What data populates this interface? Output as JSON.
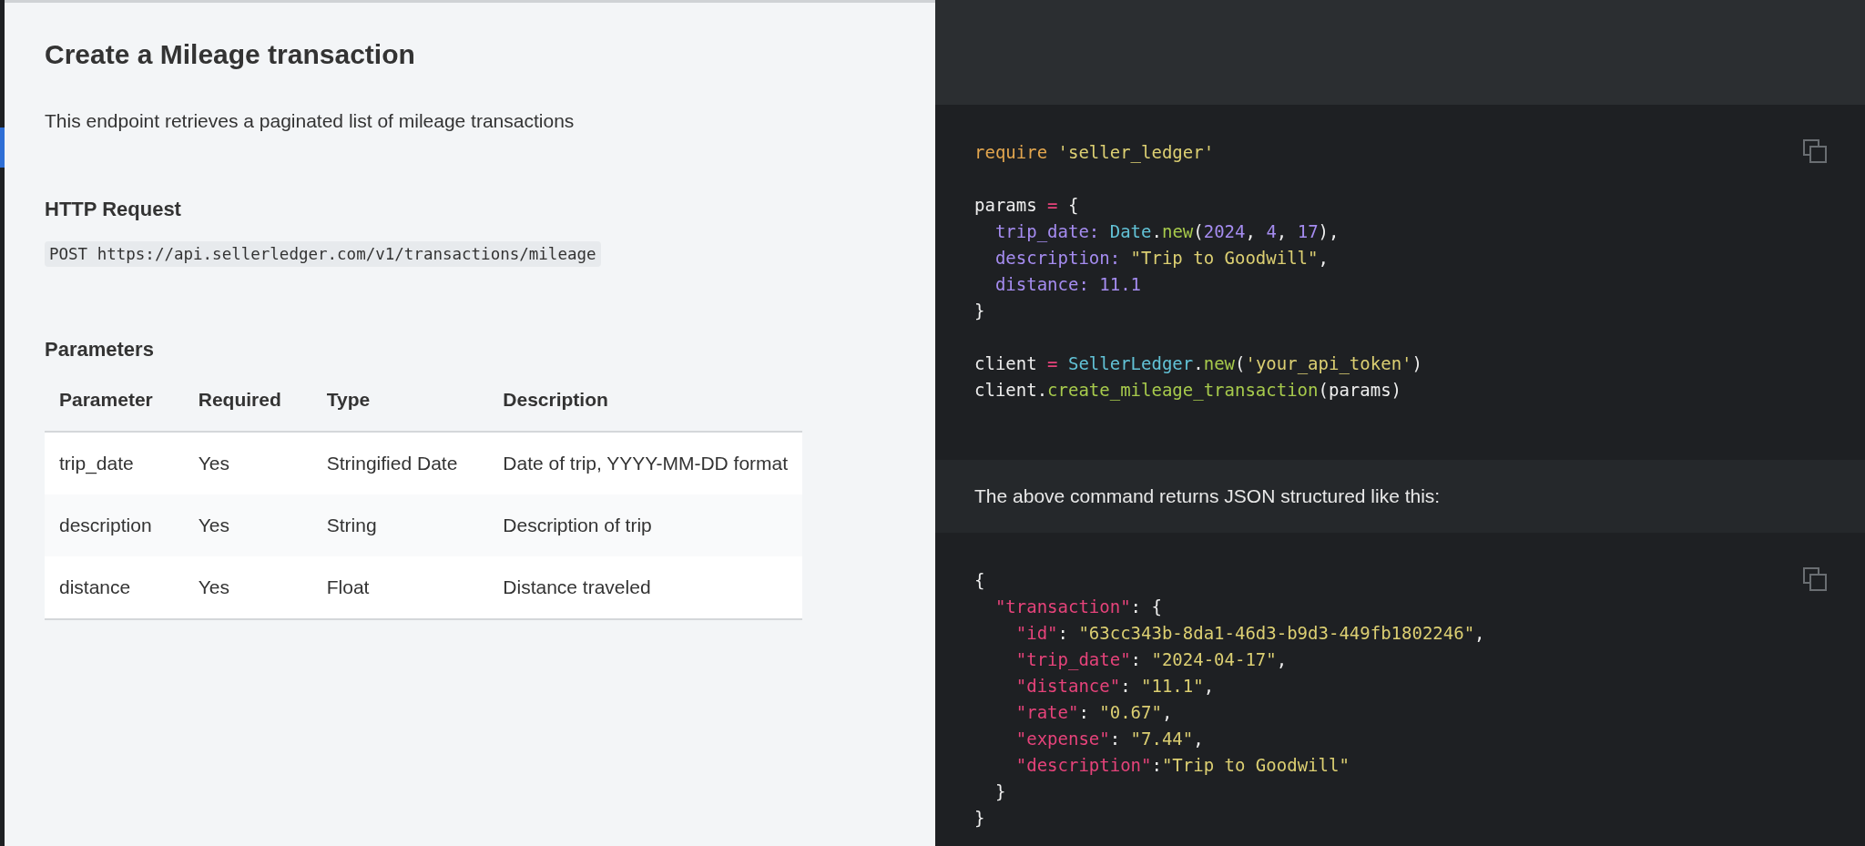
{
  "doc": {
    "title": "Create a Mileage transaction",
    "intro": "This endpoint retrieves a paginated list of mileage transactions",
    "request_heading": "HTTP Request",
    "request": "POST https://api.sellerledger.com/v1/transactions/mileage",
    "parameters_heading": "Parameters",
    "table": {
      "columns": [
        "Parameter",
        "Required",
        "Type",
        "Description"
      ],
      "rows": [
        [
          "trip_date",
          "Yes",
          "Stringified Date",
          "Date of trip, YYYY-MM-DD format"
        ],
        [
          "description",
          "Yes",
          "String",
          "Description of trip"
        ],
        [
          "distance",
          "Yes",
          "Float",
          "Distance traveled"
        ]
      ]
    }
  },
  "code_blocks": [
    {
      "groups": [
        {
          "lines": [
            [
              {
                "kind": "keyword",
                "text": "require"
              },
              {
                "kind": "string",
                "text": " 'seller_ledger'"
              }
            ]
          ]
        },
        {
          "lines": [
            [
              {
                "kind": "plain",
                "text": "params "
              },
              {
                "kind": "operator",
                "text": "="
              },
              {
                "kind": "plain",
                "text": " {"
              }
            ],
            [
              {
                "kind": "symbol",
                "text": "  trip_date: "
              },
              {
                "kind": "constant",
                "text": "Date"
              },
              {
                "kind": "plain",
                "text": "."
              },
              {
                "kind": "method",
                "text": "new"
              },
              {
                "kind": "plain",
                "text": "("
              },
              {
                "kind": "number",
                "text": "2024"
              },
              {
                "kind": "plain",
                "text": ", "
              },
              {
                "kind": "number",
                "text": "4"
              },
              {
                "kind": "plain",
                "text": ", "
              },
              {
                "kind": "number",
                "text": "17"
              },
              {
                "kind": "plain",
                "text": "),"
              }
            ],
            [
              {
                "kind": "symbol",
                "text": "  description: "
              },
              {
                "kind": "string",
                "text": "\"Trip to Goodwill\""
              },
              {
                "kind": "plain",
                "text": ","
              }
            ],
            [
              {
                "kind": "symbol",
                "text": "  distance: "
              },
              {
                "kind": "number",
                "text": "11.1"
              }
            ],
            [
              {
                "kind": "plain",
                "text": "}"
              }
            ]
          ]
        },
        {
          "lines": [
            [
              {
                "kind": "plain",
                "text": "client "
              },
              {
                "kind": "operator",
                "text": "="
              },
              {
                "kind": "constant",
                "text": " SellerLedger"
              },
              {
                "kind": "plain",
                "text": "."
              },
              {
                "kind": "method",
                "text": "new"
              },
              {
                "kind": "plain",
                "text": "("
              },
              {
                "kind": "string",
                "text": "'your_api_token'"
              },
              {
                "kind": "plain",
                "text": ")"
              }
            ],
            [
              {
                "kind": "plain",
                "text": "client."
              },
              {
                "kind": "method",
                "text": "create_mileage_transaction"
              },
              {
                "kind": "plain",
                "text": "(params)"
              }
            ]
          ]
        }
      ]
    },
    {
      "note": "The above command returns JSON structured like this:",
      "groups": [
        {
          "lines": [
            [
              {
                "kind": "plain",
                "text": "{"
              }
            ],
            [
              {
                "kind": "key",
                "text": "  \"transaction\""
              },
              {
                "kind": "plain",
                "text": ": {"
              }
            ],
            [
              {
                "kind": "key",
                "text": "    \"id\""
              },
              {
                "kind": "plain",
                "text": ": "
              },
              {
                "kind": "string",
                "text": "\"63cc343b-8da1-46d3-b9d3-449fb1802246\""
              },
              {
                "kind": "plain",
                "text": ","
              }
            ],
            [
              {
                "kind": "key",
                "text": "    \"trip_date\""
              },
              {
                "kind": "plain",
                "text": ": "
              },
              {
                "kind": "string",
                "text": "\"2024-04-17\""
              },
              {
                "kind": "plain",
                "text": ","
              }
            ],
            [
              {
                "kind": "key",
                "text": "    \"distance\""
              },
              {
                "kind": "plain",
                "text": ": "
              },
              {
                "kind": "string",
                "text": "\"11.1\""
              },
              {
                "kind": "plain",
                "text": ","
              }
            ],
            [
              {
                "kind": "key",
                "text": "    \"rate\""
              },
              {
                "kind": "plain",
                "text": ": "
              },
              {
                "kind": "string",
                "text": "\"0.67\""
              },
              {
                "kind": "plain",
                "text": ","
              }
            ],
            [
              {
                "kind": "key",
                "text": "    \"expense\""
              },
              {
                "kind": "plain",
                "text": ": "
              },
              {
                "kind": "string",
                "text": "\"7.44\""
              },
              {
                "kind": "plain",
                "text": ","
              }
            ],
            [
              {
                "kind": "key",
                "text": "    \"description\""
              },
              {
                "kind": "plain",
                "text": ":"
              },
              {
                "kind": "string",
                "text": "\"Trip to Goodwill\""
              }
            ],
            [
              {
                "kind": "plain",
                "text": "  }"
              }
            ],
            [
              {
                "kind": "plain",
                "text": "}"
              }
            ]
          ]
        }
      ]
    }
  ]
}
